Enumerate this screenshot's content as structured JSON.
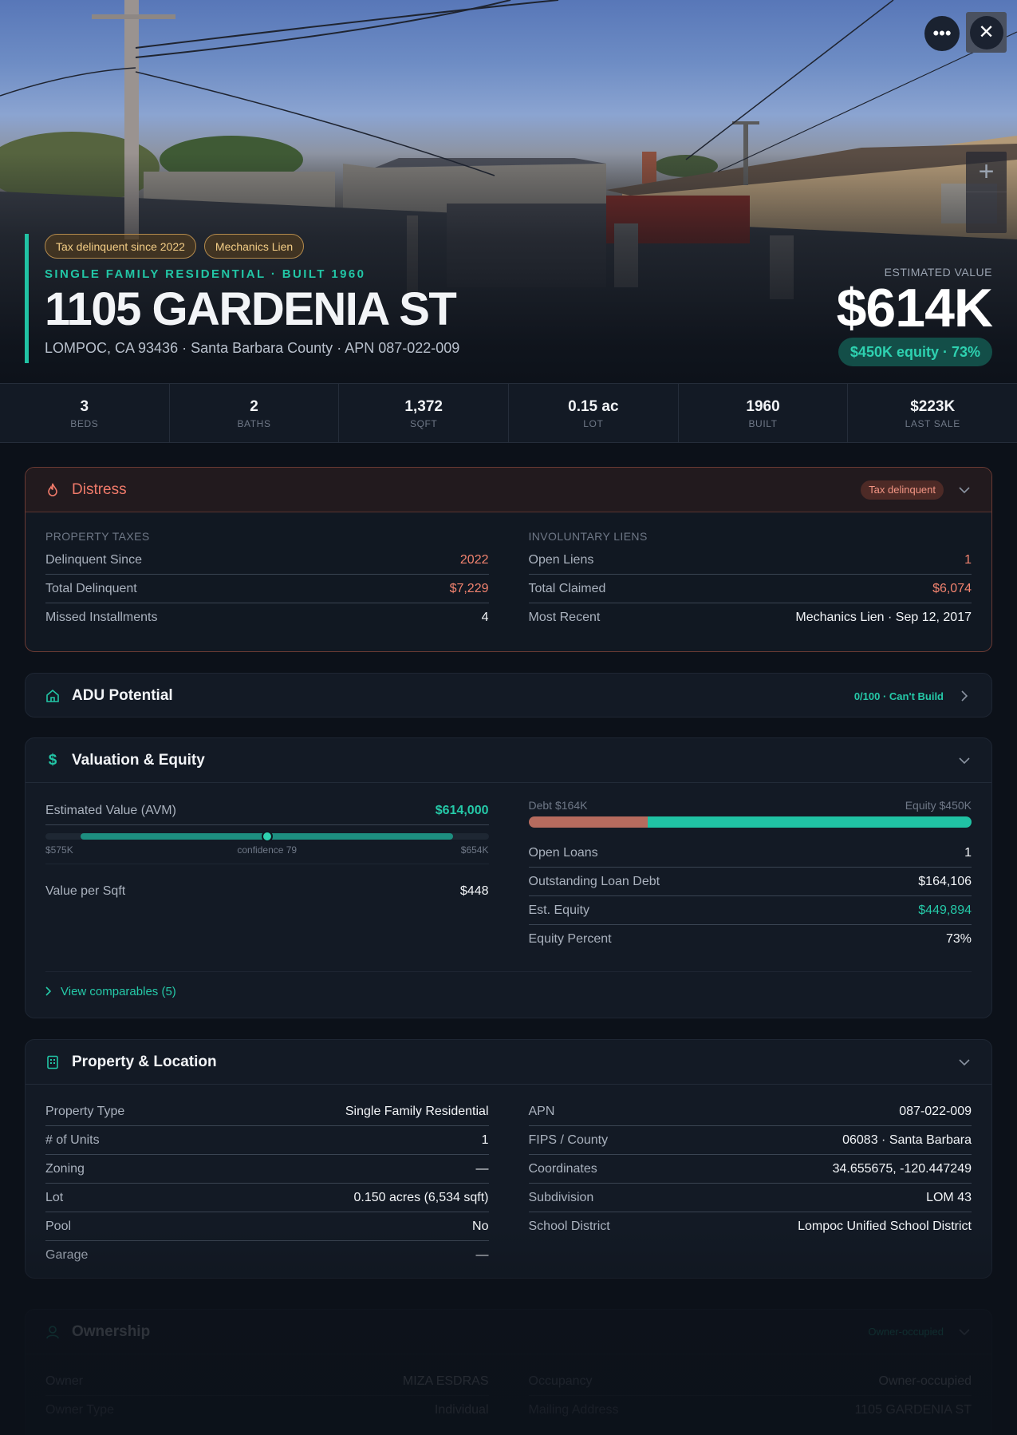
{
  "hero": {
    "tags": [
      "Tax delinquent since 2022",
      "Mechanics Lien"
    ],
    "subtype": "SINGLE FAMILY RESIDENTIAL · BUILT 1960",
    "address": "1105 GARDENIA ST",
    "location": "LOMPOC, CA 93436 · Santa Barbara County · APN 087-022-009",
    "value_label": "ESTIMATED VALUE",
    "value": "$614K",
    "equity": "$450K equity · 73%"
  },
  "stats": [
    {
      "value": "3",
      "label": "BEDS"
    },
    {
      "value": "2",
      "label": "BATHS"
    },
    {
      "value": "1,372",
      "label": "SQFT"
    },
    {
      "value": "0.15 ac",
      "label": "LOT"
    },
    {
      "value": "1960",
      "label": "BUILT"
    },
    {
      "value": "$223K",
      "label": "LAST SALE"
    }
  ],
  "distress": {
    "title": "Distress",
    "badge": "Tax delinquent",
    "left_label": "PROPERTY TAXES",
    "left_rows": [
      {
        "k": "Delinquent Since",
        "v": "2022"
      },
      {
        "k": "Total Delinquent",
        "v": "$7,229"
      },
      {
        "k": "Missed Installments",
        "v": "4"
      }
    ],
    "right_label": "INVOLUNTARY LIENS",
    "right_rows": [
      {
        "k": "Open Liens",
        "v": "1"
      },
      {
        "k": "Total Claimed",
        "v": "$6,074"
      },
      {
        "k": "Most Recent",
        "v": "Mechanics Lien · Sep 12, 2017"
      }
    ]
  },
  "adu": {
    "title": "ADU Potential",
    "badge": "0/100 · Can't Build"
  },
  "valuation": {
    "title": "Valuation & Equity",
    "avm_label": "Estimated Value (AVM)",
    "avm_value": "$614,000",
    "avm_low": "$575K",
    "avm_confidence": "confidence 79",
    "avm_high": "$654K",
    "vps_label": "Value per Sqft",
    "vps_value": "$448",
    "debt_label": "Debt $164K",
    "equity_label": "Equity $450K",
    "debt_fraction": 0.27,
    "rows": [
      {
        "k": "Open Loans",
        "v": "1"
      },
      {
        "k": "Outstanding Loan Debt",
        "v": "$164,106"
      },
      {
        "k": "Est. Equity",
        "v": "$449,894"
      },
      {
        "k": "Equity Percent",
        "v": "73%"
      }
    ],
    "comparables": "View comparables (5)"
  },
  "property": {
    "title": "Property & Location",
    "left_rows": [
      {
        "k": "Property Type",
        "v": "Single Family Residential"
      },
      {
        "k": "# of Units",
        "v": "1"
      },
      {
        "k": "Zoning",
        "v": "—"
      },
      {
        "k": "Lot",
        "v": "0.150 acres (6,534 sqft)"
      },
      {
        "k": "Pool",
        "v": "No"
      },
      {
        "k": "Garage",
        "v": "—"
      }
    ],
    "right_rows": [
      {
        "k": "APN",
        "v": "087-022-009"
      },
      {
        "k": "FIPS / County",
        "v": "06083 · Santa Barbara"
      },
      {
        "k": "Coordinates",
        "v": "34.655675, -120.447249"
      },
      {
        "k": "Subdivision",
        "v": "LOM 43"
      },
      {
        "k": "School District",
        "v": "Lompoc Unified School District"
      }
    ]
  },
  "ownership": {
    "title": "Ownership",
    "badge": "Owner-occupied",
    "left_rows": [
      {
        "k": "Owner",
        "v": "MIZA ESDRAS"
      },
      {
        "k": "Owner Type",
        "v": "Individual"
      }
    ],
    "right_rows": [
      {
        "k": "Occupancy",
        "v": "Owner-occupied"
      },
      {
        "k": "Mailing Address",
        "v": "1105 GARDENIA ST"
      }
    ]
  },
  "colors": {
    "accent": "#21c3a4",
    "danger": "#f2836f",
    "warning": "#f3cd86"
  },
  "icons": [
    "more-icon",
    "close-icon",
    "zoom-in-icon",
    "flame-icon",
    "home-icon",
    "dollar-icon",
    "building-icon",
    "person-icon",
    "chevron-down-icon",
    "chevron-right-icon"
  ]
}
